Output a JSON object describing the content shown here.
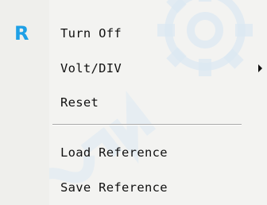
{
  "context_menu": {
    "items": [
      {
        "label": "Turn Off",
        "icon": "R",
        "icon_name": "r-badge-icon",
        "icon_color": "#1ea0e6"
      },
      {
        "label": "Volt/DIV",
        "has_submenu": true
      },
      {
        "label": "Reset"
      },
      {
        "label": "Load Reference"
      },
      {
        "label": "Save Reference"
      }
    ]
  },
  "colors": {
    "menu_background": "#f3f3f1",
    "separator": "#a8a8a8",
    "text": "#111111",
    "accent": "#1ea0e6",
    "watermark": "#cfe3f0"
  }
}
